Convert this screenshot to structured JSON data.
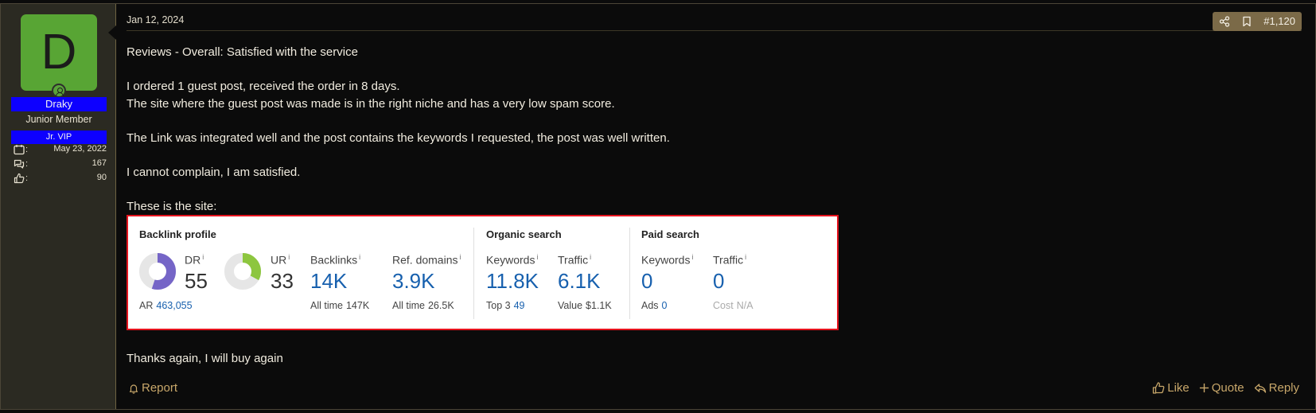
{
  "user": {
    "avatar_letter": "D",
    "username": "Draky",
    "title": "Junior Member",
    "banner": "Jr. VIP",
    "stats": [
      {
        "icon": "calendar-icon",
        "value": "May 23, 2022"
      },
      {
        "icon": "messages-icon",
        "value": "167"
      },
      {
        "icon": "thumbs-up-icon",
        "value": "90"
      }
    ],
    "colors": {
      "avatar": "#58a534",
      "banner": "#0d00ff"
    }
  },
  "post": {
    "date": "Jan 12, 2024",
    "number": "#1,120",
    "lines": [
      "Reviews - Overall: Satisfied with the service",
      "",
      "I ordered 1 guest post, received the order in 8 days.",
      "The site where the guest post was made is in the right niche and has a very low spam score.",
      "",
      "The Link was integrated well and the post contains the keywords I requested, the post was well written.",
      "",
      "I cannot complain, I am satisfied.",
      "",
      "These is the site:"
    ],
    "closing": "Thanks again, I will buy again"
  },
  "ahrefs": {
    "backlink_title": "Backlink profile",
    "organic_title": "Organic search",
    "paid_title": "Paid search",
    "info_mark": "i",
    "dr": {
      "label": "DR",
      "value": "55",
      "fill": 0.55
    },
    "ar": {
      "label": "AR",
      "value": "463,055"
    },
    "ur": {
      "label": "UR",
      "value": "33",
      "fill": 0.33
    },
    "backlinks": {
      "label": "Backlinks",
      "value": "14K",
      "sub_label": "All time",
      "sub_value": "147K"
    },
    "ref_domains": {
      "label": "Ref. domains",
      "value": "3.9K",
      "sub_label": "All time",
      "sub_value": "26.5K"
    },
    "org_keywords": {
      "label": "Keywords",
      "value": "11.8K",
      "sub_label": "Top 3",
      "sub_value": "49"
    },
    "org_traffic": {
      "label": "Traffic",
      "value": "6.1K",
      "sub_label": "Value",
      "sub_value": "$1.1K"
    },
    "paid_keywords": {
      "label": "Keywords",
      "value": "0",
      "sub_label": "Ads",
      "sub_value": "0"
    },
    "paid_traffic": {
      "label": "Traffic",
      "value": "0",
      "sub_label": "Cost",
      "sub_value": "N/A"
    },
    "colors": {
      "dr": "#7565c7",
      "ur": "#8dc63f",
      "border": "#e5141e",
      "link": "#1760ae"
    }
  },
  "footer": {
    "report": "Report",
    "like": "Like",
    "quote": "Quote",
    "reply": "Reply"
  }
}
